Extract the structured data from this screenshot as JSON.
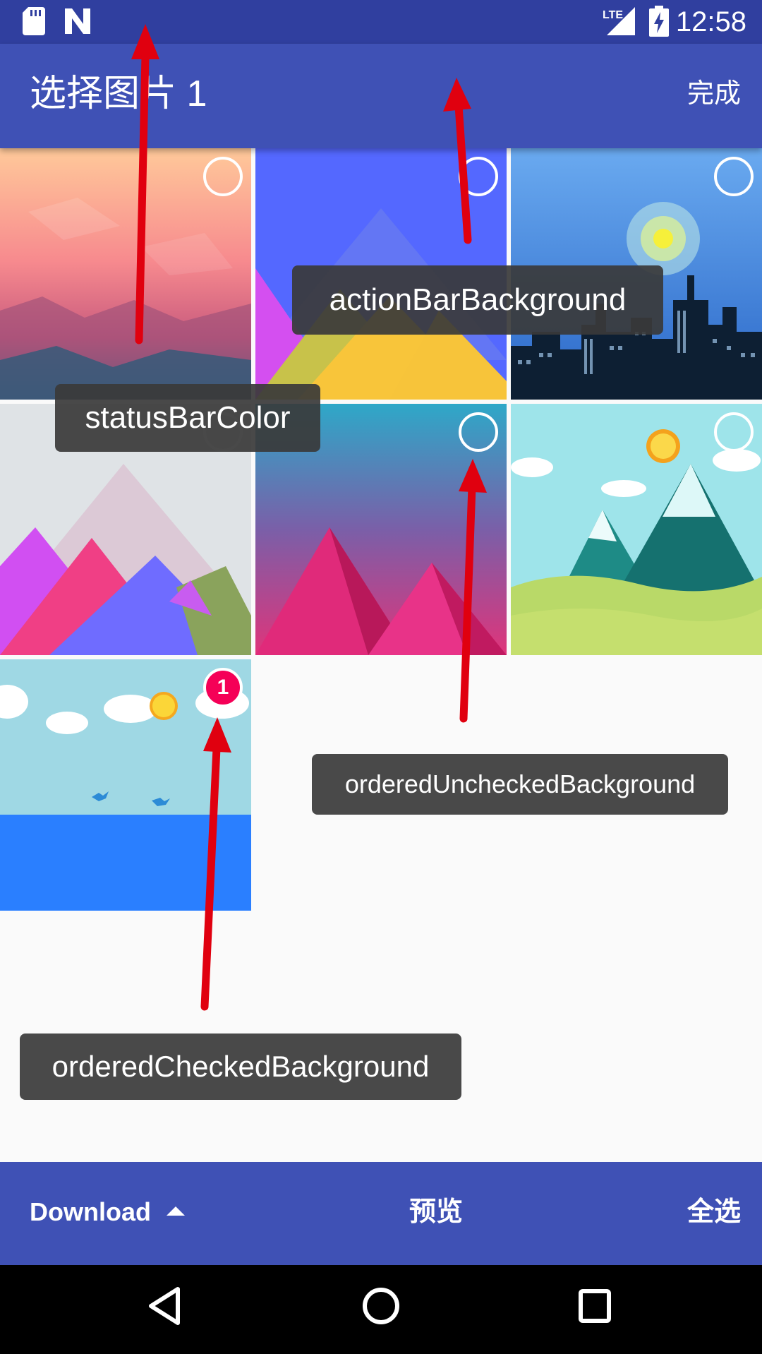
{
  "status_bar": {
    "time": "12:58",
    "network": "LTE",
    "icons": [
      "sd-card-icon",
      "n-logo-icon",
      "signal-icon",
      "battery-charging-icon"
    ]
  },
  "app_bar": {
    "title": "选择图片 1",
    "done_label": "完成",
    "background": "#3f51b5"
  },
  "grid": {
    "tiles": [
      {
        "name": "pink-crystal",
        "checked": false
      },
      {
        "name": "blue-mountains",
        "checked": false
      },
      {
        "name": "city-night",
        "checked": false
      },
      {
        "name": "grey-peaks",
        "checked": false
      },
      {
        "name": "pink-pyramids",
        "checked": false
      },
      {
        "name": "green-hills",
        "checked": false
      },
      {
        "name": "sky-sea",
        "checked": true,
        "order": "1"
      }
    ]
  },
  "bottom_bar": {
    "folder_label": "Download",
    "preview_label": "预览",
    "select_all_label": "全选"
  },
  "annotations": {
    "status_bar_color": "statusBarColor",
    "action_bar_background": "actionBarBackground",
    "ordered_unchecked_background": "orderedUncheckedBackground",
    "ordered_checked_background": "orderedCheckedBackground",
    "arrow_color": "#e0000f"
  },
  "colors": {
    "status_bar": "#303f9f",
    "action_bar": "#3f51b5",
    "checked_badge": "#f50057"
  }
}
